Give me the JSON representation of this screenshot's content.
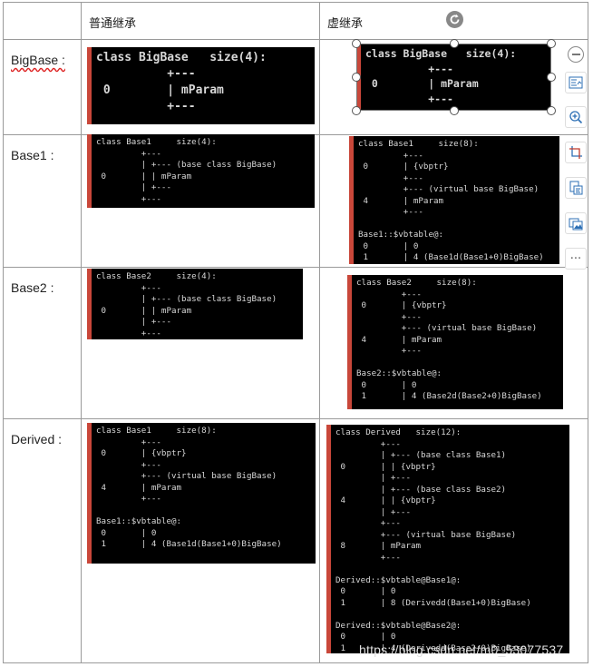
{
  "headers": {
    "col1": "普通继承",
    "col2": "虚继承"
  },
  "rows": [
    {
      "label": "BigBase :"
    },
    {
      "label": "Base1 :"
    },
    {
      "label": "Base2 :"
    },
    {
      "label": "Derived :"
    }
  ],
  "terminals": {
    "bigbase_normal": "class BigBase   size(4):\n          +---\n 0        | mParam\n          +---",
    "bigbase_virtual": "class BigBase   size(4):\n          +---\n 0        | mParam\n          +---",
    "base1_normal": "class Base1     size(4):\n         +---\n         | +--- (base class BigBase)\n 0       | | mParam\n         | +---\n         +---",
    "base1_virtual": "class Base1     size(8):\n         +---\n 0       | {vbptr}\n         +---\n         +--- (virtual base BigBase)\n 4       | mParam\n         +---\n\nBase1::$vbtable@:\n 0       | 0\n 1       | 4 (Base1d(Base1+0)BigBase)",
    "base2_normal": "class Base2     size(4):\n         +---\n         | +--- (base class BigBase)\n 0       | | mParam\n         | +---\n         +---",
    "base2_virtual": "class Base2     size(8):\n         +---\n 0       | {vbptr}\n         +---\n         +--- (virtual base BigBase)\n 4       | mParam\n         +---\n\nBase2::$vbtable@:\n 0       | 0\n 1       | 4 (Base2d(Base2+0)BigBase)",
    "derived_normal": "class Base1     size(8):\n         +---\n 0       | {vbptr}\n         +---\n         +--- (virtual base BigBase)\n 4       | mParam\n         +---\n\nBase1::$vbtable@:\n 0       | 0\n 1       | 4 (Base1d(Base1+0)BigBase)",
    "derived_virtual": "class Derived   size(12):\n         +---\n         | +--- (base class Base1)\n 0       | | {vbptr}\n         | +---\n         | +--- (base class Base2)\n 4       | | {vbptr}\n         | +---\n         +---\n         +--- (virtual base BigBase)\n 8       | mParam\n         +---\n\nDerived::$vbtable@Base1@:\n 0       | 0\n 1       | 8 (Derivedd(Base1+0)BigBase)\n\nDerived::$vbtable@Base2@:\n 0       | 0\n 1       | 4 (Derivedd(Base2+0)BigBase)"
  },
  "toolbar": {
    "rotate_icon": "rotate-icon",
    "minus_icon": "minus-icon",
    "layout_icon": "layout-options-icon",
    "zoom_icon": "zoom-in-icon",
    "crop_icon": "crop-icon",
    "wrap_icon": "wrap-text-icon",
    "replace_icon": "replace-image-icon",
    "more_label": "···"
  },
  "watermark": "https://blog.csdn.net/m0_53077537"
}
